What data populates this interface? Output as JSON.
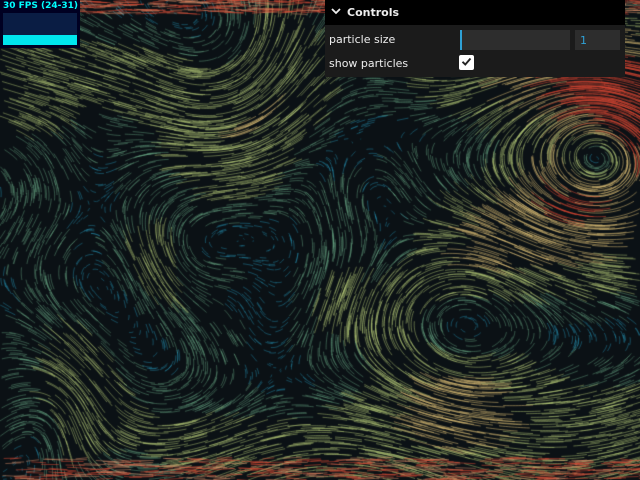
{
  "fps": {
    "label": "30 FPS (24-31)",
    "level": 0.3,
    "color": "#00e5ee"
  },
  "controls": {
    "title": "Controls",
    "chevron_icon": "chevron-down-icon",
    "particle_size": {
      "label": "particle size",
      "value": "1",
      "slider_fraction": 0.0
    },
    "show_particles": {
      "label": "show particles",
      "checked": true,
      "check_icon": "checkmark-icon"
    }
  },
  "colors": {
    "accent": "#2fa1d6",
    "panel_bg": "#1b1b1b",
    "header_bg": "#000000",
    "flow_low": "#2aa4c9",
    "flow_mid": "#b9d27c",
    "flow_high": "#d8442f"
  }
}
